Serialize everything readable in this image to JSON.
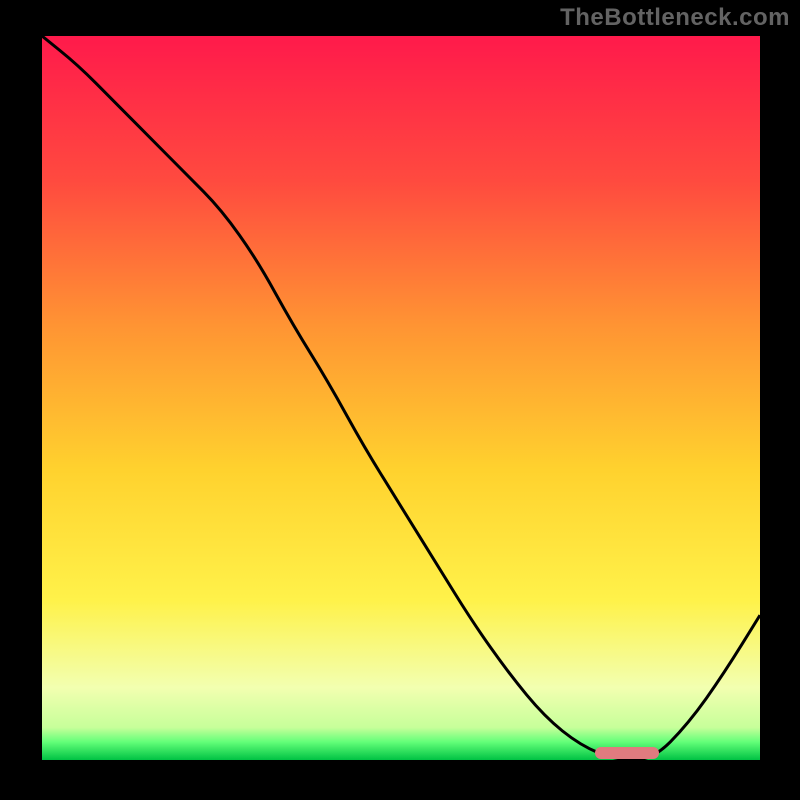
{
  "watermark": "TheBottleneck.com",
  "colors": {
    "top": "#ff1a4b",
    "upper_mid": "#ff6a3c",
    "mid": "#ffb330",
    "lower_mid": "#ffe738",
    "pale": "#f6ffb8",
    "green_band": "#2bfd6a",
    "deep_green": "#00c243",
    "frame": "#000000",
    "curve": "#000000",
    "marker": "#e07b7f",
    "watermark": "#636363"
  },
  "chart_data": {
    "type": "line",
    "title": "",
    "xlabel": "",
    "ylabel": "",
    "xlim": [
      0,
      100
    ],
    "ylim": [
      0,
      100
    ],
    "grid": false,
    "legend": false,
    "annotations": [
      "TheBottleneck.com"
    ],
    "series": [
      {
        "name": "curve",
        "x": [
          0,
          5,
          10,
          15,
          20,
          25,
          30,
          35,
          40,
          45,
          50,
          55,
          60,
          65,
          70,
          75,
          80,
          85,
          90,
          95,
          100
        ],
        "y": [
          100,
          96,
          91,
          86,
          81,
          76,
          69,
          60,
          52,
          43,
          35,
          27,
          19,
          12,
          6,
          2,
          0,
          0,
          5,
          12,
          20
        ]
      }
    ],
    "highlight_band": {
      "x_start": 77,
      "x_end": 86,
      "y": 1
    },
    "gradient_stops": [
      {
        "pos": 0.0,
        "color": "#ff1a4b"
      },
      {
        "pos": 0.2,
        "color": "#ff4a3f"
      },
      {
        "pos": 0.4,
        "color": "#ff9433"
      },
      {
        "pos": 0.6,
        "color": "#ffd22e"
      },
      {
        "pos": 0.78,
        "color": "#fff24a"
      },
      {
        "pos": 0.9,
        "color": "#f2ffb0"
      },
      {
        "pos": 0.955,
        "color": "#c7ff9a"
      },
      {
        "pos": 0.975,
        "color": "#63ff79"
      },
      {
        "pos": 1.0,
        "color": "#00c243"
      }
    ]
  }
}
